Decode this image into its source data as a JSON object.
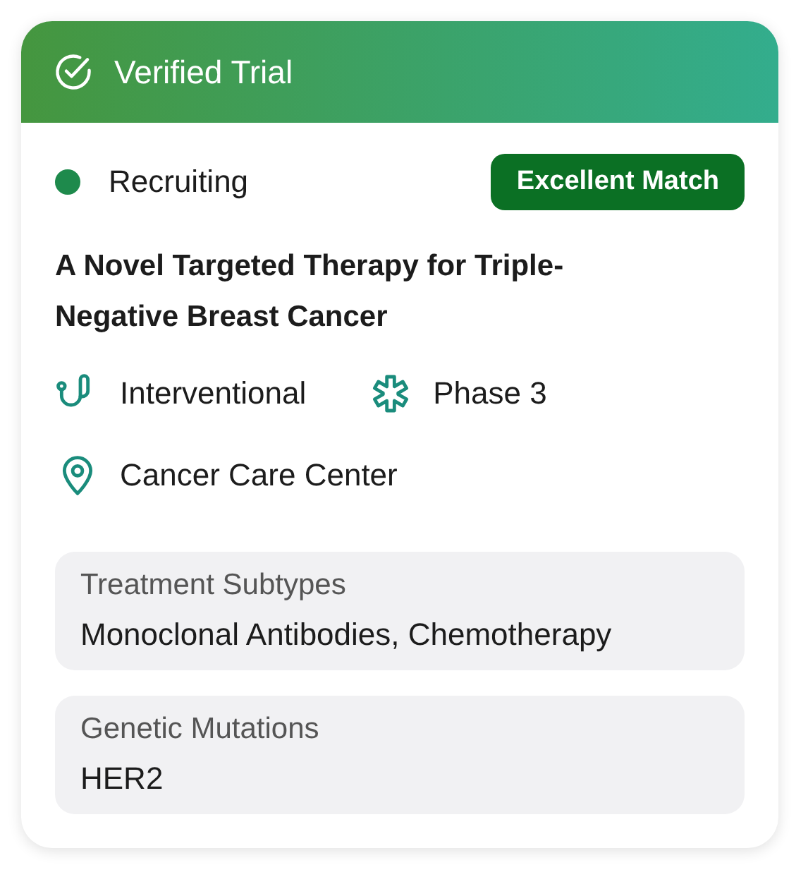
{
  "header": {
    "title": "Verified Trial"
  },
  "status": {
    "label": "Recruiting",
    "color": "#1e8a4c"
  },
  "match_badge": "Excellent Match",
  "trial_title": "A Novel Targeted Therapy for Triple-Negative Breast Cancer",
  "attributes": [
    {
      "kind": "study-type",
      "label": "Interventional"
    },
    {
      "kind": "phase",
      "label": "Phase 3"
    },
    {
      "kind": "location",
      "label": "Cancer Care Center"
    }
  ],
  "details": [
    {
      "label": "Treatment Subtypes",
      "value": "Monoclonal Antibodies, Chemotherapy"
    },
    {
      "label": "Genetic Mutations",
      "value": "HER2"
    }
  ]
}
